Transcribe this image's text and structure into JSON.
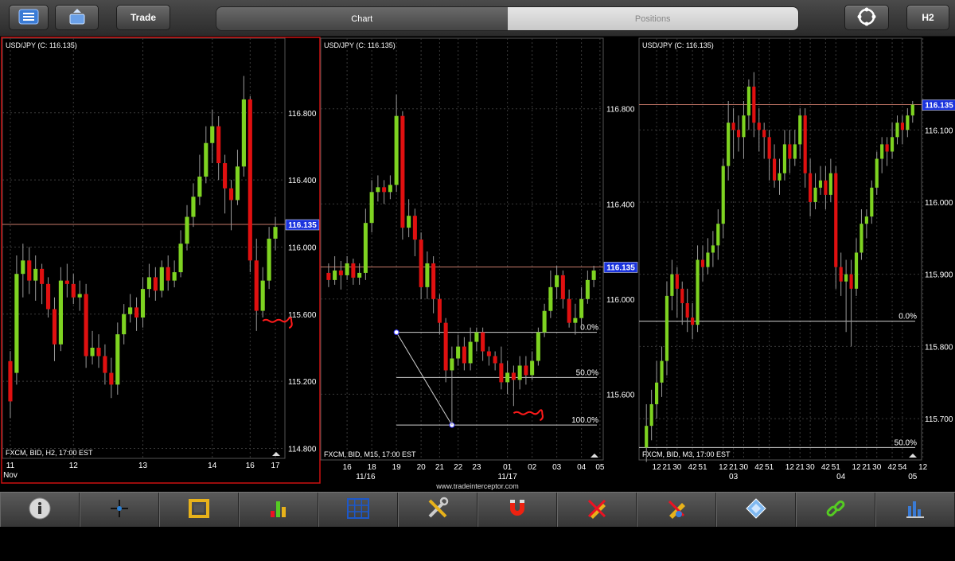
{
  "topbar": {
    "trade_label": "Trade",
    "tabs": [
      {
        "label": "Chart",
        "active": true
      },
      {
        "label": "Positions",
        "active": false
      }
    ],
    "timeframe_label": "H2"
  },
  "footer": {
    "url": "www.tradeinterceptor.com"
  },
  "colors": {
    "bull": "#7ed321",
    "bear": "#e01010",
    "grid": "#3a3a3a",
    "price_line": "#c87a6a",
    "price_tag_bg": "#1a33dd",
    "fib_line": "#cfcfcf",
    "selected_border": "#cc1111"
  },
  "toolbar": {
    "tools": [
      {
        "name": "info-icon"
      },
      {
        "name": "crosshair-icon"
      },
      {
        "name": "frame-icon"
      },
      {
        "name": "indicators-icon"
      },
      {
        "name": "grid-icon"
      },
      {
        "name": "tools-icon"
      },
      {
        "name": "magnet-icon"
      },
      {
        "name": "draw-pencil-icon"
      },
      {
        "name": "edit-pencil-icon"
      },
      {
        "name": "eraser-icon"
      },
      {
        "name": "link-icon"
      },
      {
        "name": "chart-settings-icon"
      }
    ]
  },
  "chart_data": [
    {
      "type": "candlestick",
      "title": "USD/JPY (C: 116.135)",
      "footer": "FXCM, BID, H2, 17:00 EST",
      "selected": true,
      "ylim": [
        114.75,
        117.15
      ],
      "yticks": [
        {
          "v": 116.8,
          "label": "116.800"
        },
        {
          "v": 116.4,
          "label": "116.400"
        },
        {
          "v": 116.0,
          "label": "116.000"
        },
        {
          "v": 115.6,
          "label": "115.600"
        },
        {
          "v": 115.2,
          "label": "115.200"
        },
        {
          "v": 114.8,
          "label": "114.800"
        }
      ],
      "current_price": 116.135,
      "current_price_label": "116.135",
      "xticks": [
        {
          "i": 0,
          "label": "11"
        },
        {
          "i": 10,
          "label": "12"
        },
        {
          "i": 21,
          "label": "13"
        },
        {
          "i": 32,
          "label": "14"
        },
        {
          "i": 38,
          "label": "16"
        },
        {
          "i": 42,
          "label": "17"
        }
      ],
      "xsub": [
        {
          "i": 0,
          "label": "Nov"
        }
      ],
      "annotations": [
        {
          "type": "scribble",
          "at": [
            40,
            115.56
          ]
        }
      ],
      "fibs": [],
      "candles": [
        [
          115.32,
          115.08,
          115.38,
          114.98
        ],
        [
          115.25,
          115.84,
          115.95,
          115.18
        ],
        [
          115.84,
          115.92,
          116.02,
          115.7
        ],
        [
          115.92,
          115.8,
          116.0,
          115.72
        ],
        [
          115.8,
          115.87,
          115.95,
          115.68
        ],
        [
          115.87,
          115.78,
          115.9,
          115.66
        ],
        [
          115.78,
          115.63,
          115.82,
          115.58
        ],
        [
          115.63,
          115.42,
          115.7,
          115.32
        ],
        [
          115.42,
          115.8,
          115.88,
          115.38
        ],
        [
          115.8,
          115.78,
          115.9,
          115.7
        ],
        [
          115.78,
          115.7,
          115.84,
          115.66
        ],
        [
          115.7,
          115.72,
          115.8,
          115.62
        ],
        [
          115.72,
          115.35,
          115.78,
          115.28
        ],
        [
          115.35,
          115.4,
          115.5,
          115.3
        ],
        [
          115.4,
          115.35,
          115.48,
          115.28
        ],
        [
          115.35,
          115.25,
          115.42,
          115.18
        ],
        [
          115.25,
          115.18,
          115.34,
          115.1
        ],
        [
          115.18,
          115.48,
          115.55,
          115.12
        ],
        [
          115.48,
          115.6,
          115.66,
          115.42
        ],
        [
          115.6,
          115.64,
          115.72,
          115.55
        ],
        [
          115.64,
          115.58,
          115.7,
          115.5
        ],
        [
          115.58,
          115.75,
          115.82,
          115.52
        ],
        [
          115.75,
          115.82,
          115.9,
          115.7
        ],
        [
          115.82,
          115.74,
          115.88,
          115.68
        ],
        [
          115.74,
          115.88,
          115.92,
          115.7
        ],
        [
          115.88,
          115.8,
          115.95,
          115.74
        ],
        [
          115.8,
          115.85,
          115.92,
          115.76
        ],
        [
          115.85,
          116.02,
          116.1,
          115.82
        ],
        [
          116.02,
          116.18,
          116.25,
          115.98
        ],
        [
          116.18,
          116.3,
          116.38,
          116.12
        ],
        [
          116.3,
          116.42,
          116.55,
          116.25
        ],
        [
          116.42,
          116.62,
          116.72,
          116.38
        ],
        [
          116.62,
          116.72,
          116.82,
          116.5
        ],
        [
          116.72,
          116.5,
          116.78,
          116.4
        ],
        [
          116.5,
          116.35,
          116.55,
          116.2
        ],
        [
          116.35,
          116.28,
          116.4,
          116.1
        ],
        [
          116.28,
          116.48,
          116.58,
          116.25
        ],
        [
          116.48,
          116.88,
          117.02,
          116.42
        ],
        [
          116.88,
          115.92,
          116.9,
          115.85
        ],
        [
          115.92,
          115.62,
          116.05,
          115.5
        ],
        [
          115.62,
          115.8,
          115.88,
          115.58
        ],
        [
          115.8,
          116.05,
          116.12,
          115.75
        ],
        [
          116.05,
          116.12,
          116.18,
          115.98
        ]
      ]
    },
    {
      "type": "candlestick",
      "title": "USD/JPY (C: 116.135)",
      "footer": "FXCM, BID, M15, 17:00 EST",
      "selected": false,
      "ylim": [
        115.33,
        117.03
      ],
      "yticks": [
        {
          "v": 116.8,
          "label": "116.800"
        },
        {
          "v": 116.4,
          "label": "116.400"
        },
        {
          "v": 116.0,
          "label": "116.000"
        },
        {
          "v": 115.6,
          "label": "115.600"
        }
      ],
      "current_price": 116.135,
      "current_price_label": "116.135",
      "xticks": [
        {
          "i": 3,
          "label": "16"
        },
        {
          "i": 7,
          "label": "18"
        },
        {
          "i": 11,
          "label": "19"
        },
        {
          "i": 15,
          "label": "20"
        },
        {
          "i": 18,
          "label": "21"
        },
        {
          "i": 21,
          "label": "22"
        },
        {
          "i": 24,
          "label": "23"
        },
        {
          "i": 29,
          "label": "01"
        },
        {
          "i": 33,
          "label": "02"
        },
        {
          "i": 37,
          "label": "03"
        },
        {
          "i": 41,
          "label": "04"
        },
        {
          "i": 44,
          "label": "05"
        }
      ],
      "xsub": [
        {
          "i": 6,
          "label": "11/16"
        },
        {
          "i": 29,
          "label": "11/17"
        }
      ],
      "annotations": [
        {
          "type": "scribble",
          "at": [
            30,
            115.52
          ]
        }
      ],
      "fibs": [
        {
          "y": 115.86,
          "label": "0.0%"
        },
        {
          "y": 115.67,
          "label": "50.0%"
        },
        {
          "y": 115.47,
          "label": "100.0%"
        }
      ],
      "fib_anchor": {
        "from": [
          11,
          115.86
        ],
        "to": [
          20,
          115.47
        ]
      },
      "candles": [
        [
          116.11,
          116.08,
          116.15,
          116.05
        ],
        [
          116.08,
          116.12,
          116.18,
          116.06
        ],
        [
          116.12,
          116.1,
          116.16,
          116.04
        ],
        [
          116.1,
          116.15,
          116.18,
          116.08
        ],
        [
          116.15,
          116.09,
          116.17,
          116.06
        ],
        [
          116.09,
          116.11,
          116.15,
          116.06
        ],
        [
          116.11,
          116.32,
          116.38,
          116.08
        ],
        [
          116.32,
          116.45,
          116.5,
          116.28
        ],
        [
          116.45,
          116.47,
          116.52,
          116.41
        ],
        [
          116.47,
          116.45,
          116.5,
          116.4
        ],
        [
          116.45,
          116.48,
          116.52,
          116.42
        ],
        [
          116.48,
          116.77,
          116.86,
          116.45
        ],
        [
          116.77,
          116.3,
          116.79,
          116.25
        ],
        [
          116.3,
          116.35,
          116.42,
          116.26
        ],
        [
          116.35,
          116.25,
          116.38,
          116.18
        ],
        [
          116.25,
          116.05,
          116.28,
          116.0
        ],
        [
          116.05,
          116.15,
          116.2,
          116.0
        ],
        [
          116.15,
          116.0,
          116.18,
          115.94
        ],
        [
          116.0,
          115.9,
          116.02,
          115.85
        ],
        [
          115.9,
          115.7,
          115.92,
          115.65
        ],
        [
          115.7,
          115.75,
          115.8,
          115.47
        ],
        [
          115.75,
          115.8,
          115.85,
          115.72
        ],
        [
          115.8,
          115.73,
          115.84,
          115.7
        ],
        [
          115.73,
          115.82,
          115.88,
          115.7
        ],
        [
          115.82,
          115.86,
          115.88,
          115.78
        ],
        [
          115.86,
          115.78,
          115.88,
          115.74
        ],
        [
          115.78,
          115.76,
          115.8,
          115.72
        ],
        [
          115.76,
          115.73,
          115.78,
          115.7
        ],
        [
          115.73,
          115.65,
          115.8,
          115.62
        ],
        [
          115.65,
          115.69,
          115.74,
          115.6
        ],
        [
          115.69,
          115.66,
          115.72,
          115.55
        ],
        [
          115.66,
          115.72,
          115.76,
          115.62
        ],
        [
          115.72,
          115.68,
          115.76,
          115.64
        ],
        [
          115.68,
          115.74,
          115.78,
          115.66
        ],
        [
          115.74,
          115.86,
          115.88,
          115.72
        ],
        [
          115.86,
          115.95,
          115.98,
          115.84
        ],
        [
          115.95,
          116.05,
          116.12,
          115.92
        ],
        [
          116.05,
          116.1,
          116.14,
          116.0
        ],
        [
          116.1,
          116.0,
          116.12,
          115.96
        ],
        [
          116.0,
          115.9,
          116.04,
          115.88
        ],
        [
          115.9,
          115.92,
          115.98,
          115.85
        ],
        [
          115.92,
          116.0,
          116.05,
          115.88
        ],
        [
          116.0,
          116.08,
          116.12,
          115.98
        ],
        [
          116.08,
          116.12,
          116.14,
          116.05
        ]
      ]
    },
    {
      "type": "candlestick",
      "title": "USD/JPY (C: 116.135)",
      "footer": "FXCM, BID, M3, 17:00 EST",
      "selected": false,
      "ylim": [
        115.645,
        116.205
      ],
      "yticks": [
        {
          "v": 116.1,
          "label": "116.100"
        },
        {
          "v": 116.0,
          "label": "116.000"
        },
        {
          "v": 115.9,
          "label": "115.900"
        },
        {
          "v": 115.8,
          "label": "115.800"
        },
        {
          "v": 115.7,
          "label": "115.700"
        }
      ],
      "current_price": 116.135,
      "current_price_label": "116.135",
      "xticks": [
        {
          "i": 2,
          "label": "12"
        },
        {
          "i": 4,
          "label": "21"
        },
        {
          "i": 6,
          "label": "30"
        },
        {
          "i": 9,
          "label": "42"
        },
        {
          "i": 11,
          "label": "51"
        },
        {
          "i": 15,
          "label": "12"
        },
        {
          "i": 17,
          "label": "21"
        },
        {
          "i": 19,
          "label": "30"
        },
        {
          "i": 22,
          "label": "42"
        },
        {
          "i": 24,
          "label": "51"
        },
        {
          "i": 28,
          "label": "12"
        },
        {
          "i": 30,
          "label": "21"
        },
        {
          "i": 32,
          "label": "30"
        },
        {
          "i": 35,
          "label": "42"
        },
        {
          "i": 37,
          "label": "51"
        },
        {
          "i": 41,
          "label": "12"
        },
        {
          "i": 43,
          "label": "21"
        },
        {
          "i": 45,
          "label": "30"
        },
        {
          "i": 48,
          "label": "42"
        },
        {
          "i": 50,
          "label": "54"
        },
        {
          "i": 54,
          "label": "12"
        }
      ],
      "xsub": [
        {
          "i": 17,
          "label": "03"
        },
        {
          "i": 38,
          "label": "04"
        },
        {
          "i": 52,
          "label": "05"
        }
      ],
      "annotations": [],
      "fibs": [
        {
          "y": 115.835,
          "label": "0.0%"
        },
        {
          "y": 115.66,
          "label": "50.0%"
        }
      ],
      "candles": [
        [
          115.66,
          115.69,
          115.72,
          115.64
        ],
        [
          115.69,
          115.72,
          115.74,
          115.67
        ],
        [
          115.72,
          115.75,
          115.78,
          115.7
        ],
        [
          115.75,
          115.78,
          115.8,
          115.73
        ],
        [
          115.78,
          115.87,
          115.89,
          115.76
        ],
        [
          115.87,
          115.9,
          115.92,
          115.85
        ],
        [
          115.9,
          115.88,
          115.91,
          115.84
        ],
        [
          115.88,
          115.86,
          115.89,
          115.83
        ],
        [
          115.86,
          115.84,
          115.88,
          115.82
        ],
        [
          115.84,
          115.83,
          115.86,
          115.81
        ],
        [
          115.83,
          115.92,
          115.94,
          115.82
        ],
        [
          115.92,
          115.91,
          115.94,
          115.89
        ],
        [
          115.91,
          115.93,
          115.95,
          115.9
        ],
        [
          115.93,
          115.94,
          115.96,
          115.91
        ],
        [
          115.94,
          115.97,
          115.99,
          115.92
        ],
        [
          115.97,
          116.05,
          116.06,
          115.95
        ],
        [
          116.05,
          116.11,
          116.14,
          116.03
        ],
        [
          116.11,
          116.1,
          116.13,
          116.06
        ],
        [
          116.1,
          116.09,
          116.12,
          116.07
        ],
        [
          116.09,
          116.12,
          116.14,
          116.06
        ],
        [
          116.12,
          116.16,
          116.17,
          116.1
        ],
        [
          116.16,
          116.11,
          116.18,
          116.09
        ],
        [
          116.11,
          116.1,
          116.13,
          116.07
        ],
        [
          116.1,
          116.09,
          116.11,
          116.06
        ],
        [
          116.09,
          116.06,
          116.1,
          116.03
        ],
        [
          116.06,
          116.03,
          116.08,
          116.02
        ],
        [
          116.03,
          116.04,
          116.06,
          116.01
        ],
        [
          116.04,
          116.08,
          116.1,
          116.03
        ],
        [
          116.08,
          116.06,
          116.1,
          116.04
        ],
        [
          116.06,
          116.08,
          116.1,
          116.05
        ],
        [
          116.08,
          116.12,
          116.13,
          116.06
        ],
        [
          116.12,
          116.04,
          116.13,
          116.02
        ],
        [
          116.04,
          116.0,
          116.06,
          115.98
        ],
        [
          116.0,
          116.02,
          116.04,
          115.99
        ],
        [
          116.02,
          116.03,
          116.05,
          116.01
        ],
        [
          116.03,
          116.01,
          116.05,
          115.99
        ],
        [
          116.01,
          116.04,
          116.06,
          116.0
        ],
        [
          116.04,
          115.91,
          116.05,
          115.88
        ],
        [
          115.91,
          115.89,
          115.93,
          115.87
        ],
        [
          115.89,
          115.9,
          115.92,
          115.82
        ],
        [
          115.9,
          115.88,
          115.92,
          115.8
        ],
        [
          115.88,
          115.93,
          115.95,
          115.87
        ],
        [
          115.93,
          115.97,
          115.99,
          115.92
        ],
        [
          115.97,
          115.98,
          115.99,
          115.95
        ],
        [
          115.98,
          116.02,
          116.03,
          115.97
        ],
        [
          116.02,
          116.06,
          116.07,
          116.01
        ],
        [
          116.06,
          116.08,
          116.09,
          116.04
        ],
        [
          116.08,
          116.07,
          116.09,
          116.05
        ],
        [
          116.07,
          116.09,
          116.11,
          116.06
        ],
        [
          116.09,
          116.11,
          116.12,
          116.08
        ],
        [
          116.11,
          116.1,
          116.12,
          116.08
        ],
        [
          116.1,
          116.12,
          116.13,
          116.09
        ],
        [
          116.12,
          116.135,
          116.14,
          116.11
        ]
      ]
    }
  ]
}
